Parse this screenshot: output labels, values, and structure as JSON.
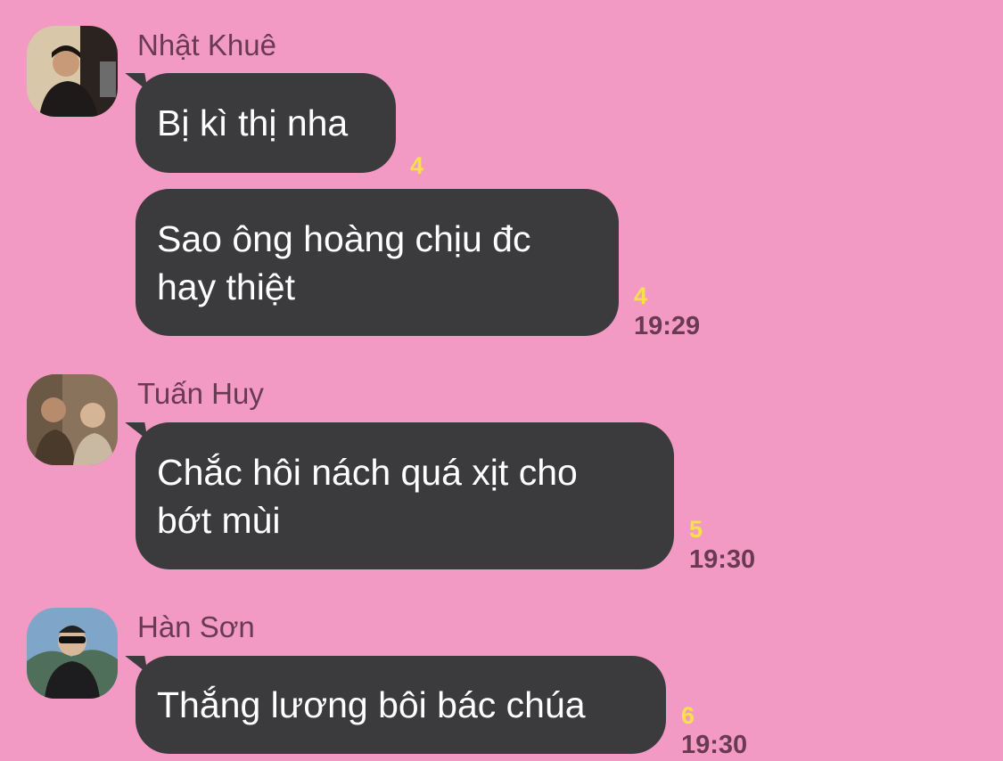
{
  "colors": {
    "background": "#f29ac3",
    "bubble": "#3b3b3e",
    "bubble_text": "#ffffff",
    "sender_name": "#6a3a55",
    "read_count": "#f7e14a",
    "timestamp": "#6a3a55"
  },
  "messages": [
    {
      "sender": "Nhật Khuê",
      "text": "Bị kì thị nha",
      "read_count": "4",
      "time": ""
    },
    {
      "sender": "",
      "text": "Sao ông hoàng chịu đc\nhay thiệt",
      "read_count": "4",
      "time": "19:29"
    },
    {
      "sender": "Tuấn Huy",
      "text": "Chắc hôi nách quá xịt cho\nbớt mùi",
      "read_count": "5",
      "time": "19:30"
    },
    {
      "sender": "Hàn Sơn",
      "text": "Thắng lương bôi bác chúa",
      "read_count": "6",
      "time": "19:30"
    }
  ]
}
